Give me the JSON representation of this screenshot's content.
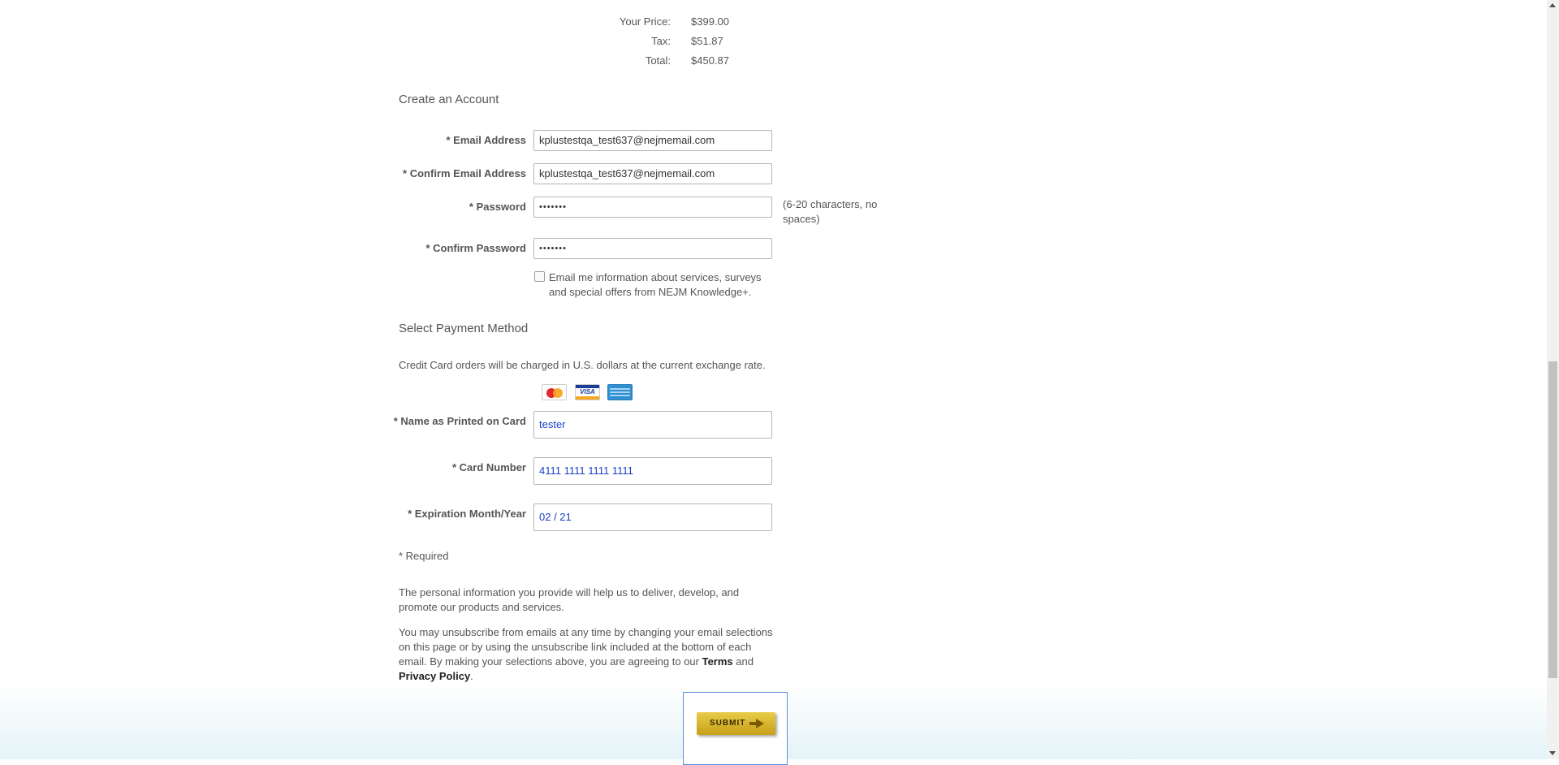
{
  "order_summary": {
    "your_price_label": "Your Price:",
    "your_price_value": "$399.00",
    "tax_label": "Tax:",
    "tax_value": "$51.87",
    "total_label": "Total:",
    "total_value": "$450.87"
  },
  "account": {
    "title": "Create an Account",
    "email_label": "Email Address",
    "email_value": "kplustestqa_test637@nejmemail.com",
    "confirm_email_label": "Confirm Email Address",
    "confirm_email_value": "kplustestqa_test637@nejmemail.com",
    "password_label": "Password",
    "password_value": "•••••••",
    "password_hint": "(6-20 characters, no spaces)",
    "confirm_password_label": "Confirm Password",
    "confirm_password_value": "•••••••",
    "optin_label": "Email me information about services, surveys and special offers from NEJM Knowledge+.",
    "optin_checked": false
  },
  "payment": {
    "title": "Select Payment Method",
    "note": "Credit Card orders will be charged in U.S. dollars at the current exchange rate.",
    "card_icons": [
      "mastercard-icon",
      "visa-icon",
      "amex-icon"
    ],
    "name_label": "Name as Printed on Card",
    "name_value": "tester",
    "number_label": "Card Number",
    "number_value": "4111 1111 1111 1111",
    "expiry_label": "Expiration Month/Year",
    "expiry_value": "02 / 21"
  },
  "required_marker": "*",
  "required_note": "* Required",
  "privacy": {
    "para1": "The personal information you provide will help us to deliver, develop, and promote our products and services.",
    "para2_prefix": "You may unsubscribe from emails at any time by changing your email selections on this page or by using the unsubscribe link included at the bottom of each email. By making your selections above, you are agreeing to our ",
    "terms_link": "Terms",
    "and_text": " and ",
    "privacy_link": "Privacy Policy",
    "para2_suffix": "."
  },
  "submit_label": "SUBMIT",
  "colors": {
    "input_value_blue": "#1a3fc7",
    "submit_gold": "#d4b22a",
    "frame_blue": "#5a8fd8"
  }
}
